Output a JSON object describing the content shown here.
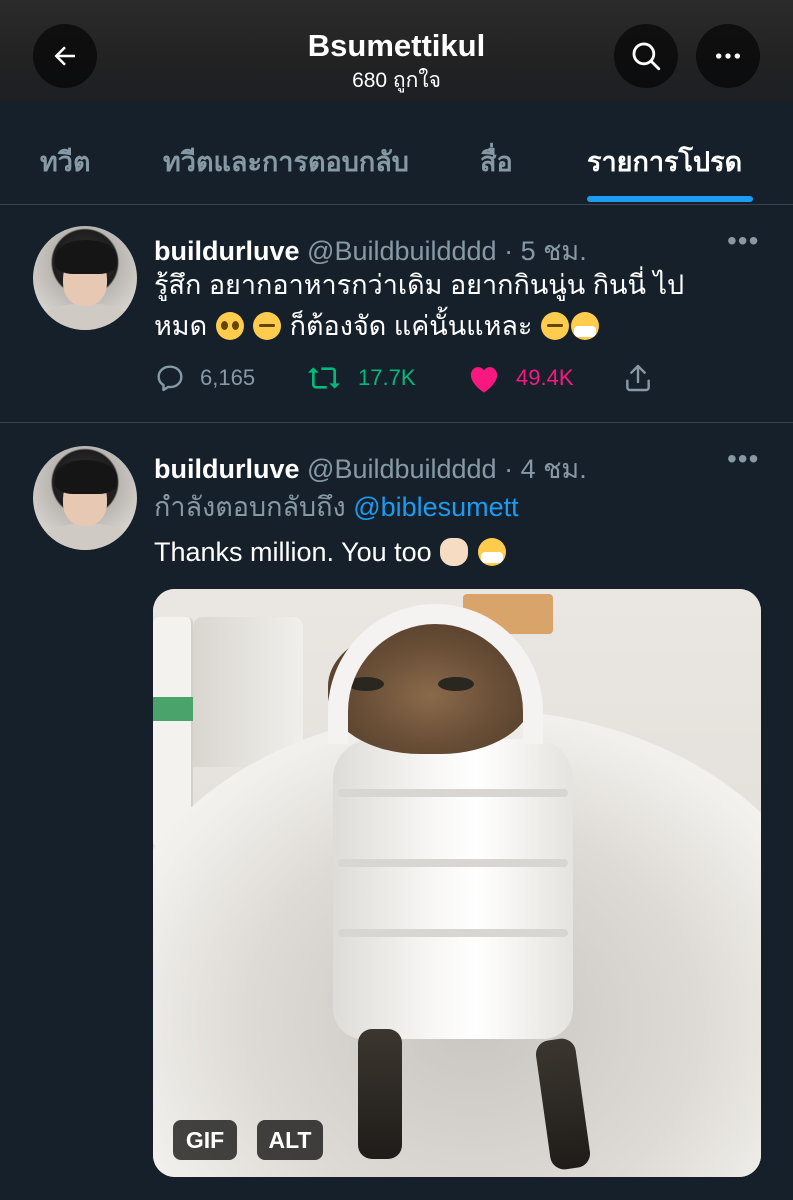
{
  "header": {
    "title": "Bsumettikul",
    "subtitle": "680 ถูกใจ",
    "back_icon": "arrow-left-icon",
    "search_icon": "search-icon",
    "more_icon": "more-horizontal-icon"
  },
  "tabs": [
    {
      "label": "ทวีต",
      "active": false
    },
    {
      "label": "ทวีตและการตอบกลับ",
      "active": false
    },
    {
      "label": "สื่อ",
      "active": false
    },
    {
      "label": "รายการโปรด",
      "active": true
    }
  ],
  "tweets": [
    {
      "name": "buildurluve",
      "handle": "@Buildbuildddd",
      "time": " · 5 ชม.",
      "text_line1": "รู้สึก อยากอาหารกว่าเดิม อยากกินนู่น กินนี่ ไป",
      "text_line2a": "หมด ",
      "text_line2b": " ก็ต้องจัด แค่นั้นแหละ ",
      "emojis": [
        "pleading-face-emoji",
        "expressionless-face-emoji",
        "woozy-face-emoji",
        "face-with-mask-emoji"
      ],
      "stats": {
        "replies": "6,165",
        "retweets": "17.7K",
        "likes": "49.4K"
      },
      "liked": true,
      "retweeted": true
    },
    {
      "name": "buildurluve",
      "handle": "@Buildbuildddd",
      "time": " · 4 ชม.",
      "reply_prefix": "กำลังตอบกลับถึง ",
      "reply_mention": "@biblesumett",
      "text": "Thanks million. You too ",
      "emojis": [
        "victory-hand-emoji",
        "face-with-mask-emoji"
      ],
      "media": {
        "type": "gif",
        "badge_gif": "GIF",
        "badge_alt": "ALT"
      }
    }
  ],
  "colors": {
    "background": "#15202b",
    "accent": "#1d9bf0",
    "retweet": "#00ba7c",
    "like": "#f91880",
    "muted": "#8899a6"
  }
}
